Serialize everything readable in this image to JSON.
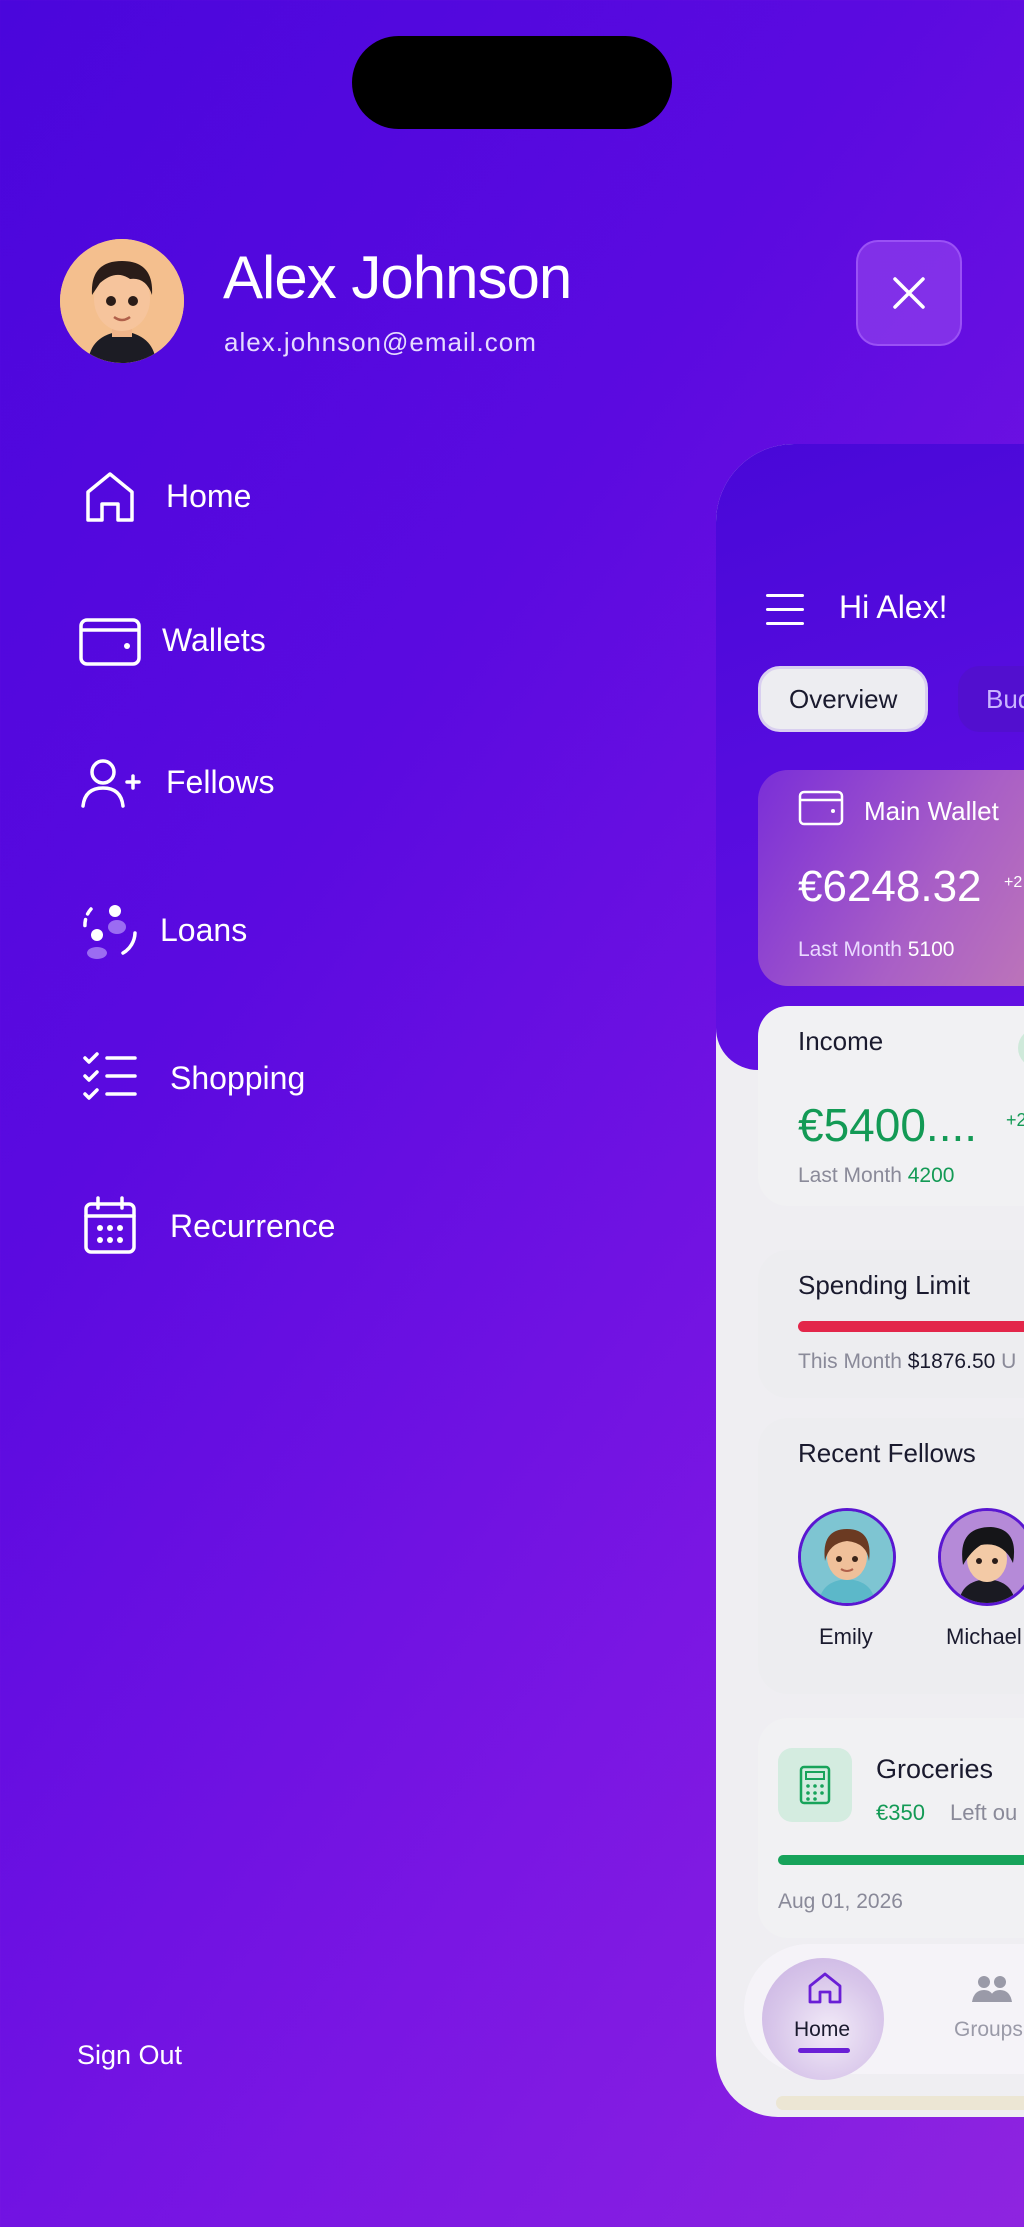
{
  "profile": {
    "name": "Alex Johnson",
    "email": "alex.johnson@email.com"
  },
  "menu": {
    "items": [
      {
        "label": "Home",
        "icon": "home-icon"
      },
      {
        "label": "Wallets",
        "icon": "wallet-icon"
      },
      {
        "label": "Fellows",
        "icon": "add-user-icon"
      },
      {
        "label": "Loans",
        "icon": "loans-icon"
      },
      {
        "label": "Shopping",
        "icon": "checklist-icon"
      },
      {
        "label": "Recurrence",
        "icon": "calendar-icon"
      }
    ],
    "sign_out": "Sign Out"
  },
  "preview": {
    "greeting": "Hi Alex!",
    "tabs": [
      "Overview",
      "Bud"
    ],
    "main_wallet": {
      "title": "Main Wallet",
      "amount": "€6248.32",
      "change": "+2",
      "last_month_label": "Last Month",
      "last_month_value": "5100"
    },
    "income": {
      "title": "Income",
      "amount": "€5400....",
      "change": "+2",
      "last_month_label": "Last Month",
      "last_month_value": "4200"
    },
    "spending_limit": {
      "title": "Spending Limit",
      "this_month_label": "This Month",
      "this_month_value": "$1876.50",
      "trailing": "U"
    },
    "recent_fellows": {
      "title": "Recent Fellows",
      "people": [
        "Emily",
        "Michael"
      ]
    },
    "groceries": {
      "title": "Groceries",
      "amount": "€350",
      "left": "Left ou",
      "date": "Aug 01, 2026"
    },
    "nav": {
      "home": "Home",
      "groups": "Groups"
    }
  },
  "colors": {
    "background_start": "#4a06dc",
    "background_end": "#8e24e0",
    "income_green": "#139a55",
    "spending_red": "#e3264a",
    "accent_purple": "#6a1fd6"
  }
}
